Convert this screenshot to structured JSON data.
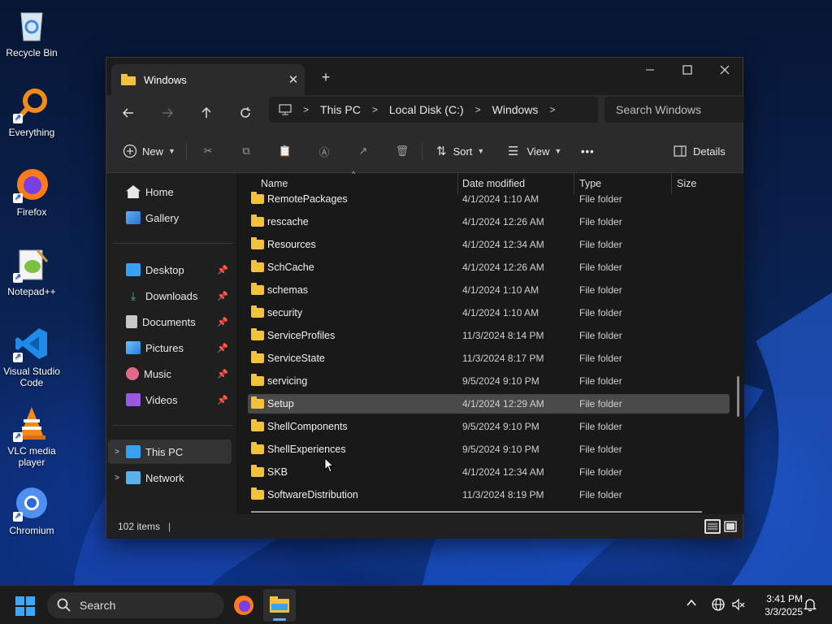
{
  "desktop": {
    "icons": [
      {
        "label": "Recycle Bin"
      },
      {
        "label": "Everything"
      },
      {
        "label": "Firefox"
      },
      {
        "label": "Notepad++"
      },
      {
        "label": "Visual Studio Code"
      },
      {
        "label": "VLC media player"
      },
      {
        "label": "Chromium"
      }
    ]
  },
  "window": {
    "tab_title": "Windows",
    "tab_close": "✕",
    "new_tab": "+",
    "controls": {
      "minimize": "—",
      "maximize": "☐",
      "close": "✕"
    }
  },
  "navbar": {
    "breadcrumbs": [
      "This PC",
      "Local Disk (C:)",
      "Windows"
    ],
    "search_placeholder": "Search Windows"
  },
  "toolbar": {
    "new_label": "New",
    "sort_label": "Sort",
    "view_label": "View",
    "more_label": "•••",
    "details_label": "Details"
  },
  "sidebar": {
    "quick": [
      {
        "label": "Home"
      },
      {
        "label": "Gallery"
      }
    ],
    "pinned": [
      {
        "label": "Desktop"
      },
      {
        "label": "Downloads"
      },
      {
        "label": "Documents"
      },
      {
        "label": "Pictures"
      },
      {
        "label": "Music"
      },
      {
        "label": "Videos"
      }
    ],
    "drives": [
      {
        "label": "This PC"
      },
      {
        "label": "Network"
      }
    ]
  },
  "columns": {
    "name": "Name",
    "date": "Date modified",
    "type": "Type",
    "size": "Size"
  },
  "files": [
    {
      "name": "RemotePackages",
      "date": "4/1/2024 1:10 AM",
      "type": "File folder"
    },
    {
      "name": "rescache",
      "date": "4/1/2024 12:26 AM",
      "type": "File folder"
    },
    {
      "name": "Resources",
      "date": "4/1/2024 12:34 AM",
      "type": "File folder"
    },
    {
      "name": "SchCache",
      "date": "4/1/2024 12:26 AM",
      "type": "File folder"
    },
    {
      "name": "schemas",
      "date": "4/1/2024 1:10 AM",
      "type": "File folder"
    },
    {
      "name": "security",
      "date": "4/1/2024 1:10 AM",
      "type": "File folder"
    },
    {
      "name": "ServiceProfiles",
      "date": "11/3/2024 8:14 PM",
      "type": "File folder"
    },
    {
      "name": "ServiceState",
      "date": "11/3/2024 8:17 PM",
      "type": "File folder"
    },
    {
      "name": "servicing",
      "date": "9/5/2024 9:10 PM",
      "type": "File folder"
    },
    {
      "name": "Setup",
      "date": "4/1/2024 12:29 AM",
      "type": "File folder"
    },
    {
      "name": "ShellComponents",
      "date": "9/5/2024 9:10 PM",
      "type": "File folder"
    },
    {
      "name": "ShellExperiences",
      "date": "9/5/2024 9:10 PM",
      "type": "File folder"
    },
    {
      "name": "SKB",
      "date": "4/1/2024 12:34 AM",
      "type": "File folder"
    },
    {
      "name": "SoftwareDistribution",
      "date": "11/3/2024 8:19 PM",
      "type": "File folder"
    }
  ],
  "selected_file": "Setup",
  "status": {
    "item_count": "102 items"
  },
  "taskbar": {
    "search_label": "Search",
    "time": "3:41 PM",
    "date": "3/3/2025"
  },
  "colors": {
    "accent": "#0078d4",
    "folder": "#f2c23a"
  }
}
